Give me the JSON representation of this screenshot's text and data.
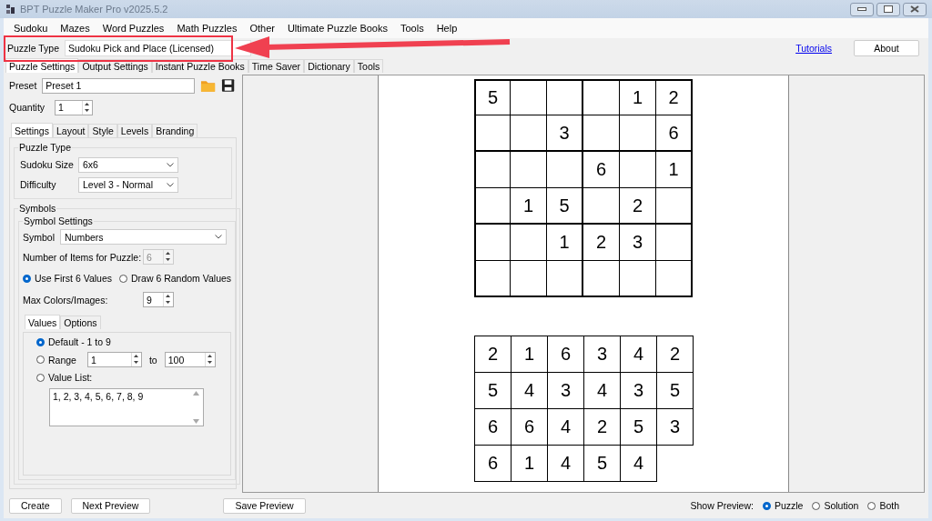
{
  "window": {
    "title": "BPT Puzzle Maker Pro v2025.5.2"
  },
  "menu": [
    "Sudoku",
    "Mazes",
    "Word Puzzles",
    "Math Puzzles",
    "Other",
    "Ultimate Puzzle Books",
    "Tools",
    "Help"
  ],
  "puzzle_type": {
    "label": "Puzzle Type",
    "value": "Sudoku Pick and Place (Licensed)"
  },
  "tutorials_link": "Tutorials",
  "about_button": "About",
  "main_tabs": [
    {
      "label": "Puzzle Settings",
      "selected": true
    },
    {
      "label": "Output Settings",
      "selected": false
    },
    {
      "label": "Instant Puzzle Books",
      "selected": false
    },
    {
      "label": "Time Saver",
      "selected": false
    },
    {
      "label": "Dictionary",
      "selected": false
    },
    {
      "label": "Tools",
      "selected": false
    }
  ],
  "preset": {
    "label": "Preset",
    "value": "Preset 1"
  },
  "quantity": {
    "label": "Quantity",
    "value": "1"
  },
  "settings_tabs": [
    {
      "label": "Settings",
      "selected": true
    },
    {
      "label": "Layout",
      "selected": false
    },
    {
      "label": "Style",
      "selected": false
    },
    {
      "label": "Levels",
      "selected": false
    },
    {
      "label": "Branding",
      "selected": false
    }
  ],
  "puzzle_type_group": {
    "title": "Puzzle Type",
    "fields": [
      {
        "label": "Sudoku Size",
        "value": "6x6"
      },
      {
        "label": "Difficulty",
        "value": "Level 3 - Normal"
      }
    ]
  },
  "symbols_group": {
    "title": "Symbols",
    "settings_title": "Symbol Settings",
    "symbol": {
      "label": "Symbol",
      "value": "Numbers"
    },
    "items_count": {
      "label": "Number of Items for Puzzle:",
      "value": "6",
      "disabled": true
    },
    "pick_mode": [
      {
        "label": "Use First 6 Values",
        "selected": true
      },
      {
        "label": "Draw 6 Random Values",
        "selected": false
      }
    ],
    "max_colors": {
      "label": "Max Colors/Images:",
      "value": "9"
    }
  },
  "values_tabs": [
    {
      "label": "Values",
      "selected": true
    },
    {
      "label": "Options",
      "selected": false
    }
  ],
  "value_source": [
    {
      "kind": "plain",
      "label": "Default - 1 to 9",
      "selected": true
    },
    {
      "kind": "range",
      "label": "Range",
      "selected": false,
      "from": "1",
      "to_label": "to",
      "to": "100"
    },
    {
      "kind": "list",
      "label": "Value List:",
      "selected": false,
      "list": "1, 2, 3, 4, 5, 6, 7, 8, 9"
    }
  ],
  "puzzle_grid": [
    [
      {
        "value": "5"
      },
      {
        "empty": true
      },
      {
        "empty": true
      },
      {
        "empty": true
      },
      {
        "value": "1"
      },
      {
        "value": "2"
      }
    ],
    [
      {
        "empty": true
      },
      {
        "empty": true
      },
      {
        "value": "3"
      },
      {
        "empty": true
      },
      {
        "empty": true
      },
      {
        "value": "6"
      }
    ],
    [
      {
        "empty": true
      },
      {
        "empty": true
      },
      {
        "empty": true
      },
      {
        "value": "6"
      },
      {
        "empty": true
      },
      {
        "value": "1"
      }
    ],
    [
      {
        "empty": true
      },
      {
        "value": "1"
      },
      {
        "value": "5"
      },
      {
        "empty": true
      },
      {
        "value": "2"
      },
      {
        "empty": true
      }
    ],
    [
      {
        "empty": true
      },
      {
        "empty": true
      },
      {
        "value": "1"
      },
      {
        "value": "2"
      },
      {
        "value": "3"
      },
      {
        "empty": true
      }
    ],
    [
      {
        "empty": true
      },
      {
        "empty": true
      },
      {
        "empty": true
      },
      {
        "empty": true
      },
      {
        "empty": true
      },
      {
        "empty": true
      }
    ]
  ],
  "pieces": [
    [
      "2",
      "1",
      "6",
      "3",
      "4",
      "2"
    ],
    [
      "5",
      "4",
      "3",
      "4",
      "3",
      "5"
    ],
    [
      "6",
      "6",
      "4",
      "2",
      "5",
      "3"
    ],
    [
      "6",
      "1",
      "4",
      "5",
      "4"
    ]
  ],
  "buttons": [
    "Create",
    "Next Preview",
    "Save Preview"
  ],
  "show_preview": {
    "label": "Show Preview:",
    "options": [
      {
        "label": "Puzzle",
        "selected": true
      },
      {
        "label": "Solution",
        "selected": false
      },
      {
        "label": "Both",
        "selected": false
      }
    ]
  }
}
